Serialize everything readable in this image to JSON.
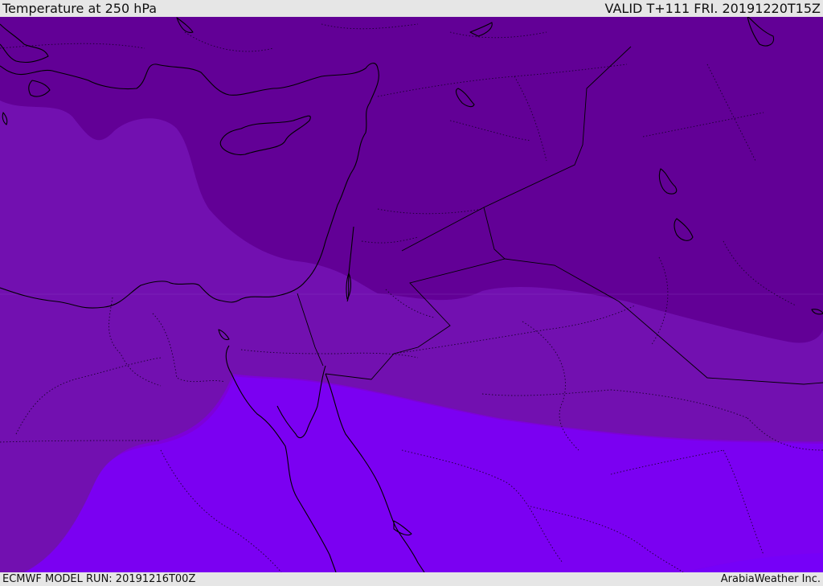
{
  "header": {
    "title": "Temperature at 250 hPa",
    "valid": "VALID T+111 FRI. 20191220T15Z"
  },
  "footer": {
    "model_run": "ECMWF MODEL RUN: 20191216T00Z",
    "credit": "ArabiaWeather Inc."
  },
  "colors": {
    "band_coldest": "#620096",
    "band_mid": "#7210b0",
    "band_warmer": "#7d00d9",
    "band_warmest": "#7b00f2",
    "coastline": "#000000",
    "frame": "#e6e6e6"
  }
}
